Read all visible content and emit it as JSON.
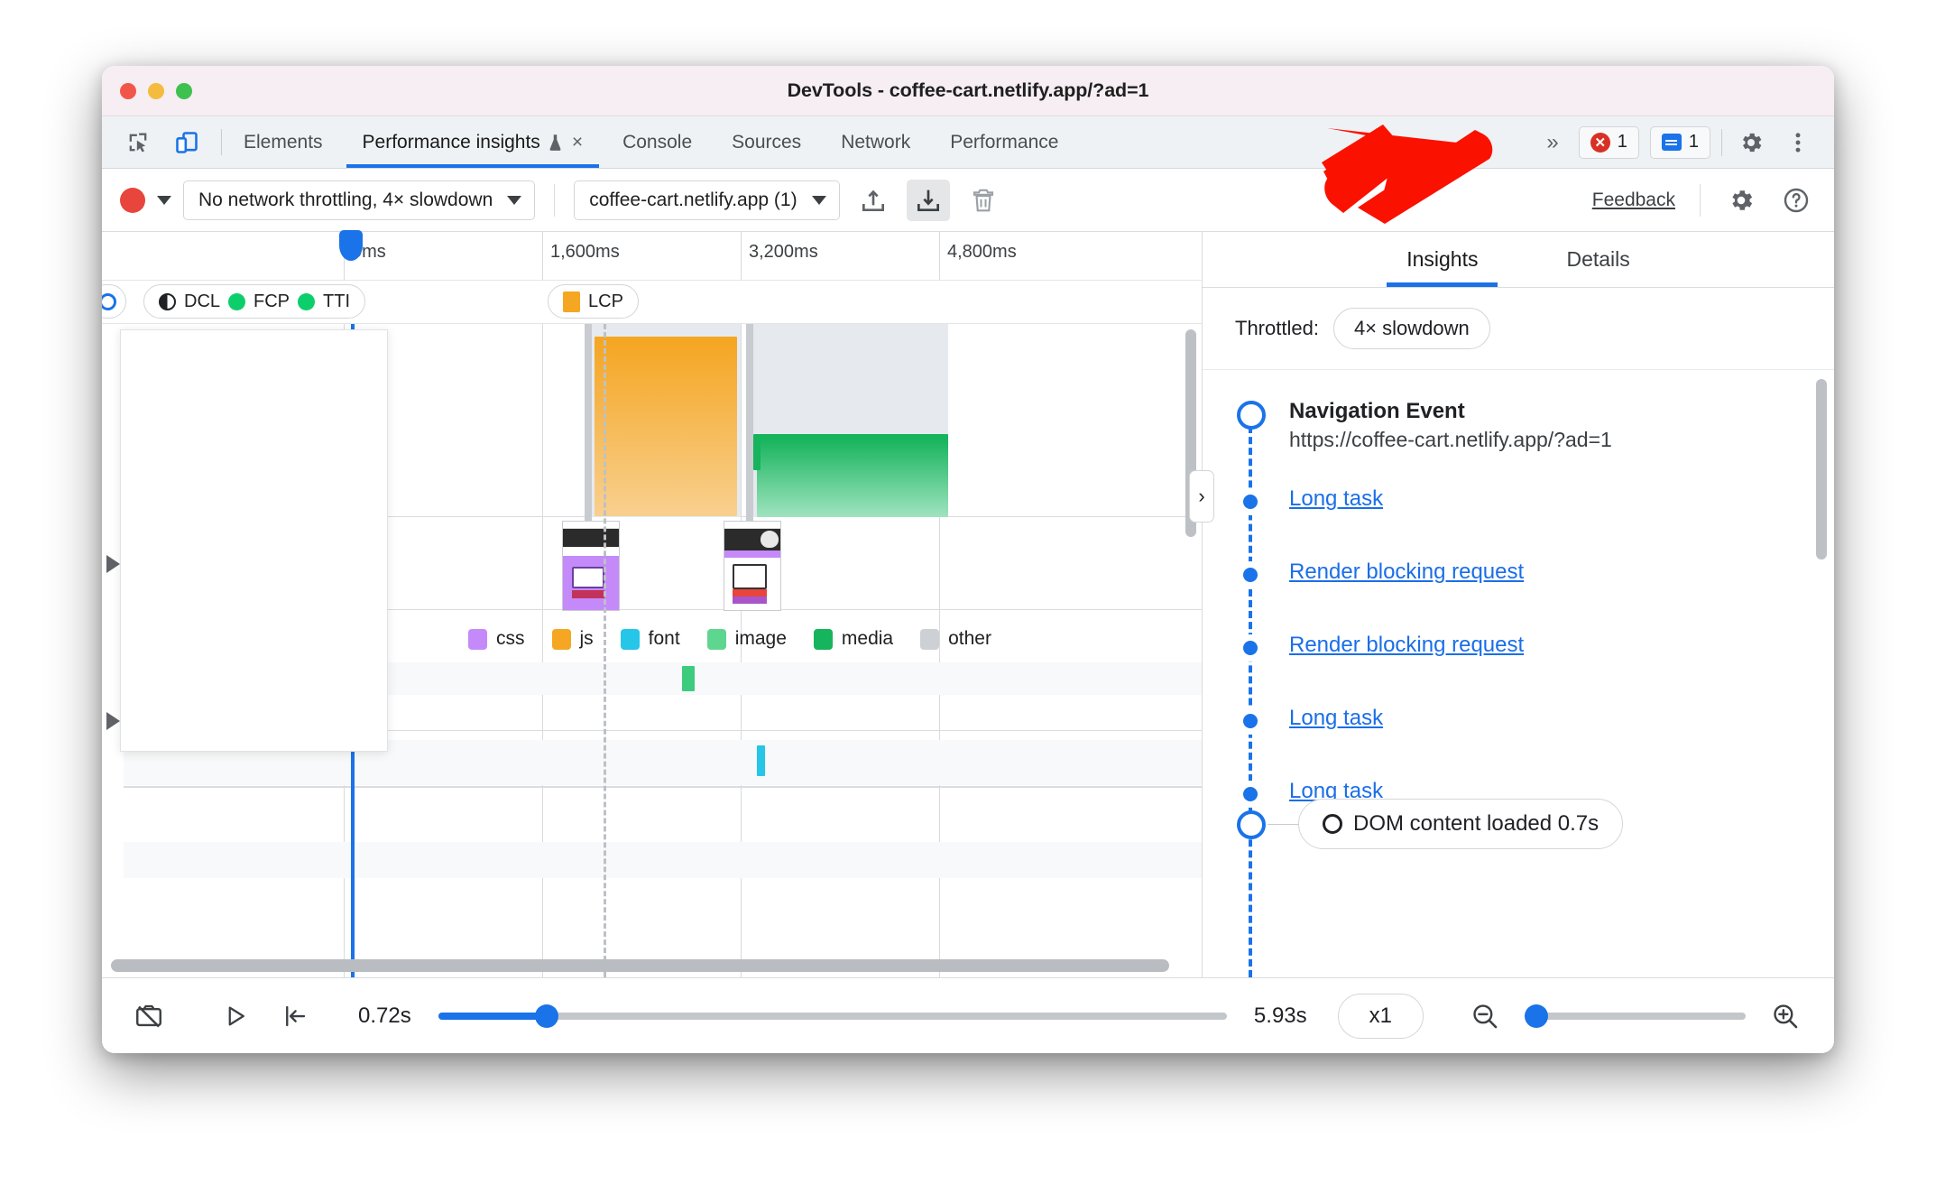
{
  "window": {
    "title": "DevTools - coffee-cart.netlify.app/?ad=1"
  },
  "tabbar": {
    "inspect_icon": "inspect-element-icon",
    "device_icon": "device-toolbar-icon",
    "tabs": [
      {
        "label": "Elements",
        "active": false,
        "closable": false
      },
      {
        "label": "Performance insights",
        "active": true,
        "closable": true,
        "flask": true
      },
      {
        "label": "Console",
        "active": false,
        "closable": false
      },
      {
        "label": "Sources",
        "active": false,
        "closable": false
      },
      {
        "label": "Network",
        "active": false,
        "closable": false
      },
      {
        "label": "Performance",
        "active": false,
        "closable": false
      }
    ],
    "more_label": "»",
    "close_label": "×",
    "error_count": "1",
    "message_count": "1",
    "settings_icon": "gear-icon",
    "more_options_icon": "three-dot-menu-icon"
  },
  "toolbar": {
    "record_icon": "record-button",
    "record_dropdown_icon": "chevron-down-icon",
    "throttling_value": "No network throttling, 4× slowdown",
    "page_value": "coffee-cart.netlify.app (1)",
    "upload_icon": "upload-icon",
    "download_icon": "download-icon",
    "trash_icon": "trash-icon",
    "feedback_label": "Feedback",
    "settings_icon": "gear-icon",
    "help_icon": "help-icon"
  },
  "timeline": {
    "ticks": [
      "0ms",
      "1,600ms",
      "3,200ms",
      "4,800ms"
    ],
    "markers": [
      {
        "label": "DCL",
        "type": "dcl"
      },
      {
        "label": "FCP",
        "type": "green"
      },
      {
        "label": "TTI",
        "type": "green"
      }
    ],
    "lcp_label": "LCP",
    "legend": [
      {
        "label": "css",
        "color": "#c58af9"
      },
      {
        "label": "js",
        "color": "#f5a623"
      },
      {
        "label": "font",
        "color": "#25c6e8"
      },
      {
        "label": "image",
        "color": "#5fd68f"
      },
      {
        "label": "media",
        "color": "#16b45c"
      },
      {
        "label": "other",
        "color": "#cdd1d5"
      }
    ],
    "collapse_icon": "chevron-right-icon"
  },
  "sidebar": {
    "tabs": [
      {
        "label": "Insights",
        "active": true
      },
      {
        "label": "Details",
        "active": false
      }
    ],
    "throttled_label": "Throttled:",
    "throttled_value": "4× slowdown",
    "navigation": {
      "title": "Navigation Event",
      "url": "https://coffee-cart.netlify.app/?ad=1"
    },
    "items": [
      {
        "label": "Long task"
      },
      {
        "label": "Render blocking request"
      },
      {
        "label": "Render blocking request"
      },
      {
        "label": "Long task"
      },
      {
        "label": "Long task"
      }
    ],
    "dcl_chip": "DOM content loaded 0.7s"
  },
  "bottombar": {
    "screenshot_icon": "screenshot-off-icon",
    "play_icon": "play-icon",
    "jump-to-start_icon": "jump-to-start-icon",
    "start_time": "0.72s",
    "end_time": "5.93s",
    "speed": "x1",
    "zoom_out_icon": "zoom-out-icon",
    "zoom_in_icon": "zoom-in-icon"
  },
  "annotation": {
    "arrow": "red-pointer-arrow"
  }
}
